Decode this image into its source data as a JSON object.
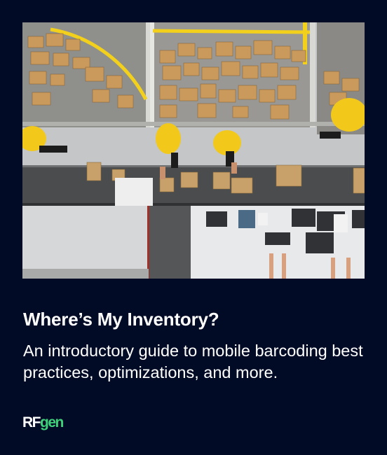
{
  "card": {
    "image_alt": "Overhead view of warehouse workers sorting packages on a conveyor belt",
    "title": "Where’s My Inventory?",
    "subtitle": "An introductory guide to mobile barcoding best practices, optimizations, and more.",
    "logo": {
      "part1": "RF",
      "part2": "gen"
    }
  },
  "colors": {
    "background": "#010b26",
    "text": "#ffffff",
    "logo_accent": "#3fd17a",
    "worker_shirt": "#f2c81a",
    "box": "#c99a5c"
  }
}
